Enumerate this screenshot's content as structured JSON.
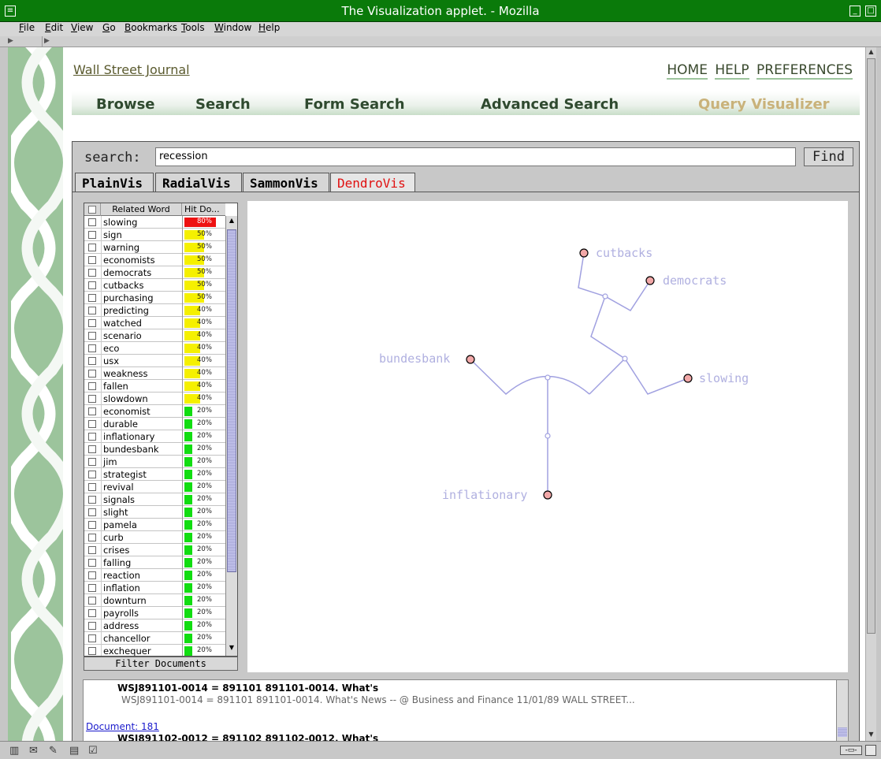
{
  "window": {
    "title": "The Visualization applet. - Mozilla"
  },
  "menu": [
    "File",
    "Edit",
    "View",
    "Go",
    "Bookmarks",
    "Tools",
    "Window",
    "Help"
  ],
  "page": {
    "site_link": "Wall Street Journal",
    "top_links": [
      "HOME",
      "HELP",
      "PREFERENCES"
    ],
    "nav": [
      "Browse",
      "Search",
      "Form Search",
      "Advanced Search",
      "Query Visualizer"
    ],
    "active_nav": "Query Visualizer"
  },
  "applet": {
    "search_label": "search:",
    "search_value": "recession",
    "find_label": "Find",
    "tabs": [
      "PlainVis",
      "RadialVis",
      "SammonVis",
      "DendroVis"
    ],
    "active_tab": "DendroVis",
    "table": {
      "col_word": "Related Word",
      "col_hits": "Hit Do...",
      "rows": [
        {
          "word": "slowing",
          "pct": "80%",
          "level": "high"
        },
        {
          "word": "sign",
          "pct": "50%",
          "level": "mid"
        },
        {
          "word": "warning",
          "pct": "50%",
          "level": "mid"
        },
        {
          "word": "economists",
          "pct": "50%",
          "level": "mid"
        },
        {
          "word": "democrats",
          "pct": "50%",
          "level": "mid"
        },
        {
          "word": "cutbacks",
          "pct": "50%",
          "level": "mid"
        },
        {
          "word": "purchasing",
          "pct": "50%",
          "level": "mid"
        },
        {
          "word": "predicting",
          "pct": "40%",
          "level": "mid"
        },
        {
          "word": "watched",
          "pct": "40%",
          "level": "mid"
        },
        {
          "word": "scenario",
          "pct": "40%",
          "level": "mid"
        },
        {
          "word": "eco",
          "pct": "40%",
          "level": "mid"
        },
        {
          "word": "usx",
          "pct": "40%",
          "level": "mid"
        },
        {
          "word": "weakness",
          "pct": "40%",
          "level": "mid"
        },
        {
          "word": "fallen",
          "pct": "40%",
          "level": "mid"
        },
        {
          "word": "slowdown",
          "pct": "40%",
          "level": "mid"
        },
        {
          "word": "economist",
          "pct": "20%",
          "level": "low"
        },
        {
          "word": "durable",
          "pct": "20%",
          "level": "low"
        },
        {
          "word": "inflationary",
          "pct": "20%",
          "level": "low"
        },
        {
          "word": "bundesbank",
          "pct": "20%",
          "level": "low"
        },
        {
          "word": "jim",
          "pct": "20%",
          "level": "low"
        },
        {
          "word": "strategist",
          "pct": "20%",
          "level": "low"
        },
        {
          "word": "revival",
          "pct": "20%",
          "level": "low"
        },
        {
          "word": "signals",
          "pct": "20%",
          "level": "low"
        },
        {
          "word": "slight",
          "pct": "20%",
          "level": "low"
        },
        {
          "word": "pamela",
          "pct": "20%",
          "level": "low"
        },
        {
          "word": "curb",
          "pct": "20%",
          "level": "low"
        },
        {
          "word": "crises",
          "pct": "20%",
          "level": "low"
        },
        {
          "word": "falling",
          "pct": "20%",
          "level": "low"
        },
        {
          "word": "reaction",
          "pct": "20%",
          "level": "low"
        },
        {
          "word": "inflation",
          "pct": "20%",
          "level": "low"
        },
        {
          "word": "downturn",
          "pct": "20%",
          "level": "low"
        },
        {
          "word": "payrolls",
          "pct": "20%",
          "level": "low"
        },
        {
          "word": "address",
          "pct": "20%",
          "level": "low"
        },
        {
          "word": "chancellor",
          "pct": "20%",
          "level": "low"
        },
        {
          "word": "exchequer",
          "pct": "20%",
          "level": "low"
        }
      ]
    },
    "filter_label": "Filter Documents",
    "dendrogram_leaves": [
      "cutbacks",
      "democrats",
      "bundesbank",
      "slowing",
      "inflationary"
    ],
    "results": {
      "line1": "WSJ891101-0014 = 891101 891101-0014. What's",
      "line2": "WSJ891101-0014 = 891101 891101-0014. What's News -- @ Business and Finance 11/01/89 WALL STREET...",
      "doc_link": "Document: 181",
      "line3": "WSJ891102-0012 = 891102 891102-0012. What's"
    }
  },
  "colors": {
    "title_bar": "#0a7a0a",
    "bar_high": "#ee1111",
    "bar_mid": "#f5f000",
    "bar_low": "#11dd11",
    "active_tab": "#e01010",
    "dendro_line": "#a0a0e0",
    "leaf_node": "#f2a8a8"
  }
}
